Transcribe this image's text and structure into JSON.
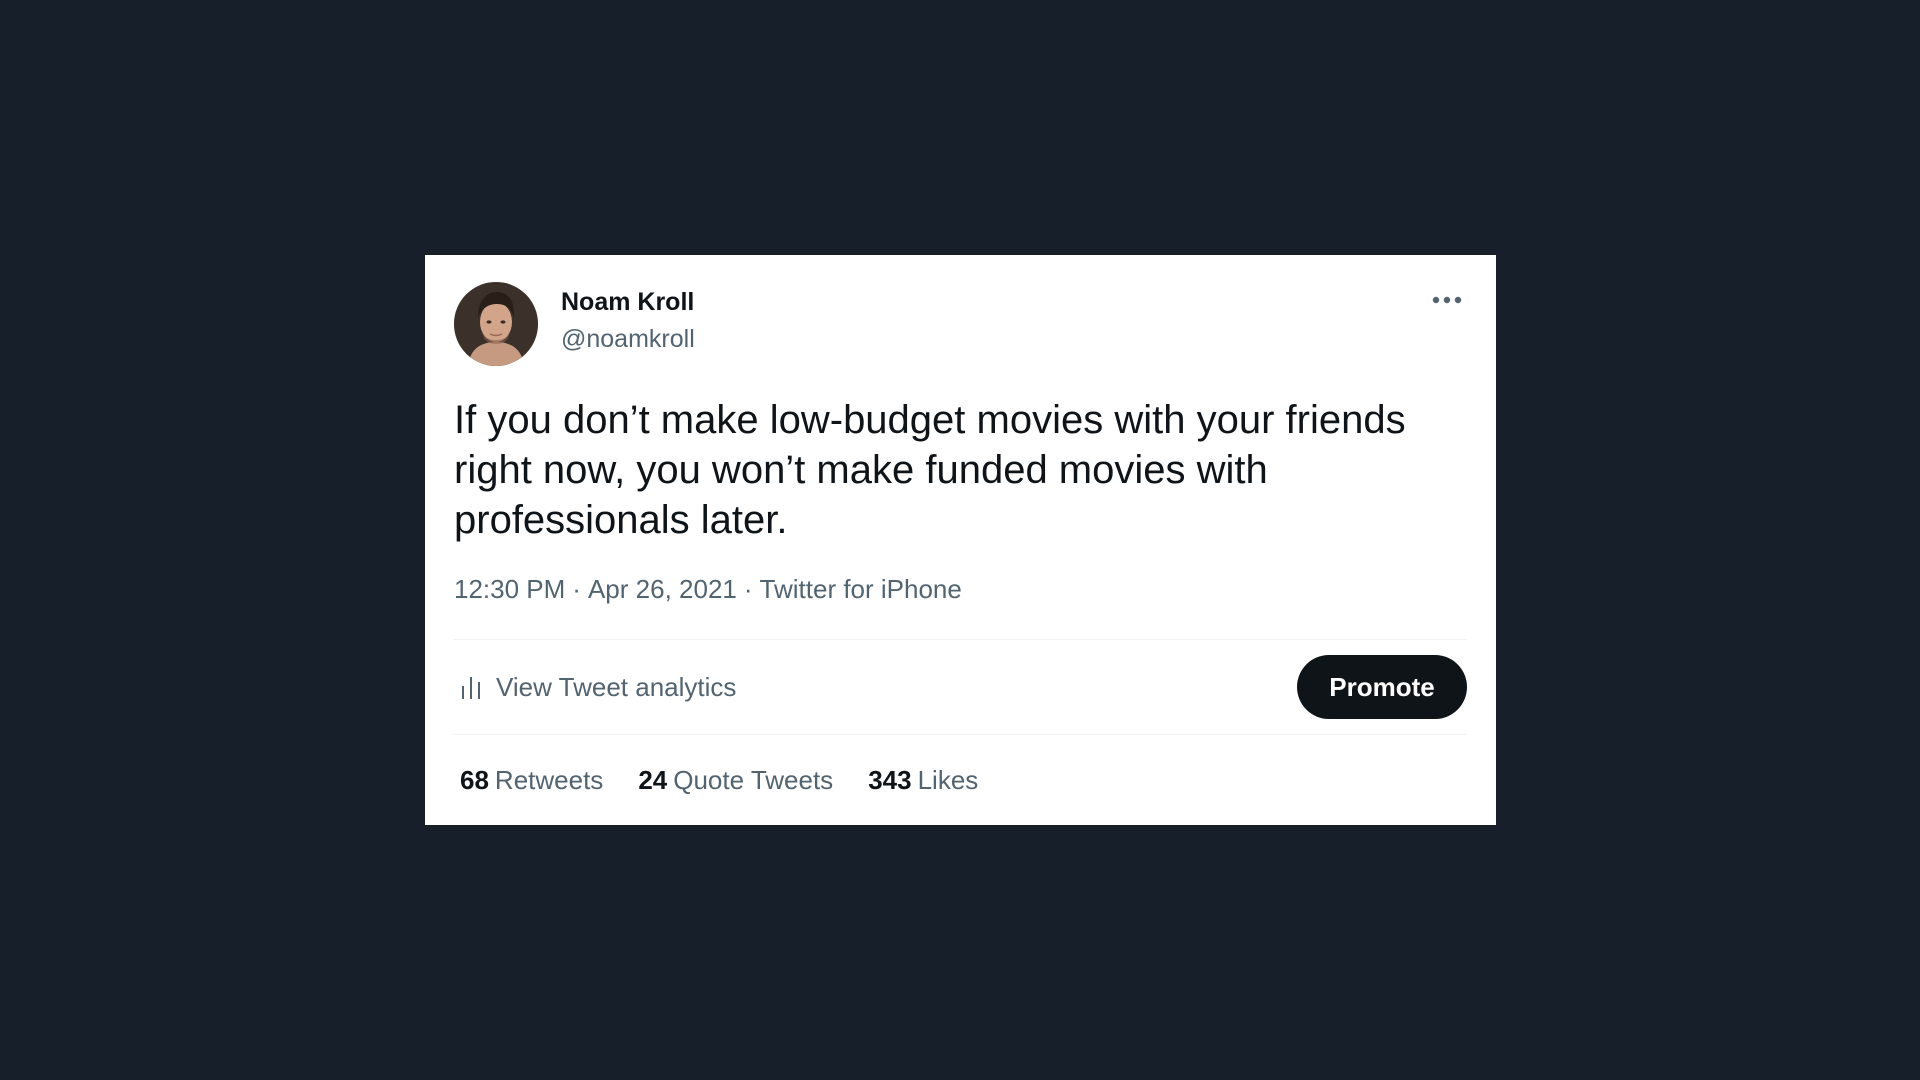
{
  "tweet": {
    "author_name": "Noam Kroll",
    "author_handle": "@noamkroll",
    "text": "If you don’t make low-budget movies with your friends right now, you won’t make funded movies with professionals later.",
    "time": "12:30 PM",
    "date": "Apr 26, 2021",
    "source": "Twitter for iPhone",
    "separator": "·"
  },
  "actions": {
    "analytics_label": "View Tweet analytics",
    "promote_label": "Promote"
  },
  "stats": {
    "retweets_count": "68",
    "retweets_label": "Retweets",
    "quotes_count": "24",
    "quotes_label": "Quote Tweets",
    "likes_count": "343",
    "likes_label": "Likes"
  },
  "icons": {
    "more": "more-horizontal-icon",
    "analytics": "analytics-bars-icon"
  },
  "colors": {
    "background": "#17202a",
    "card": "#ffffff",
    "primary_text": "#0f1419",
    "secondary_text": "#536471",
    "promote_bg": "#0f1419"
  }
}
